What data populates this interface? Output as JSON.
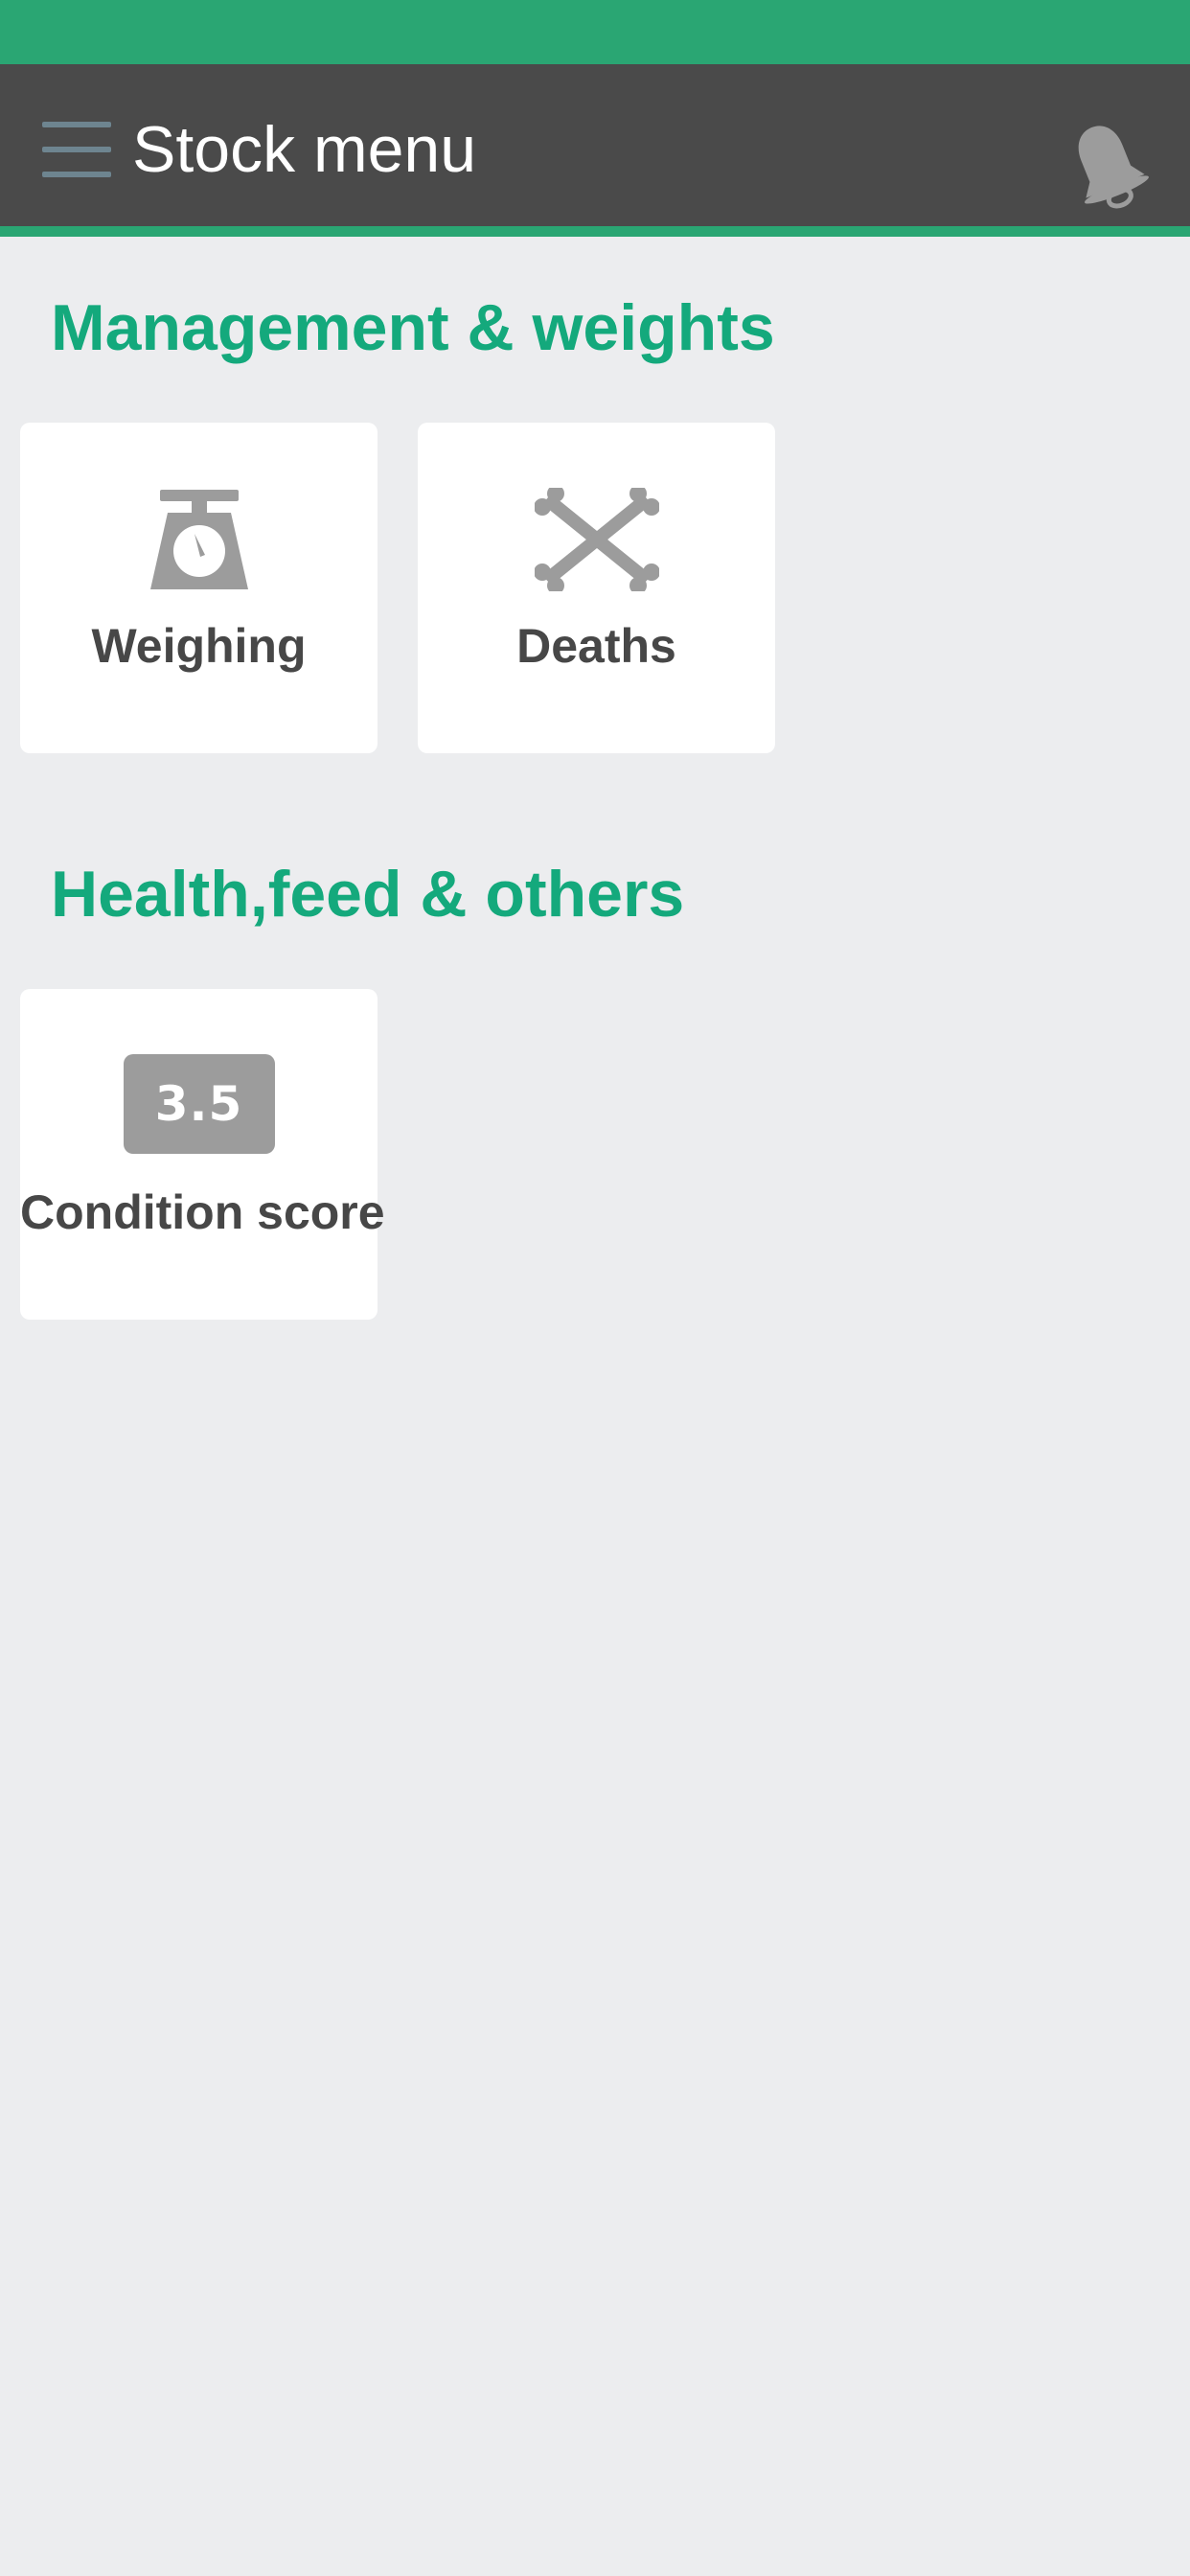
{
  "app_bar": {
    "title": "Stock menu",
    "menu_icon": "hamburger-menu-icon",
    "notification_icon": "bell-icon"
  },
  "colors": {
    "status_bar": "#2aa673",
    "app_bar": "#4a4a4a",
    "accent": "#14a97c",
    "background": "#ecedef",
    "tile": "#ffffff",
    "icon": "#9c9c9c"
  },
  "sections": [
    {
      "heading": "Management & weights",
      "tiles": [
        {
          "label": "Weighing",
          "icon": "scale-icon"
        },
        {
          "label": "Deaths",
          "icon": "crossbones-icon"
        }
      ]
    },
    {
      "heading": "Health,feed & others",
      "tiles": [
        {
          "label": "Condition score",
          "icon": "condition-score-icon",
          "icon_text": "3.5"
        }
      ]
    }
  ]
}
